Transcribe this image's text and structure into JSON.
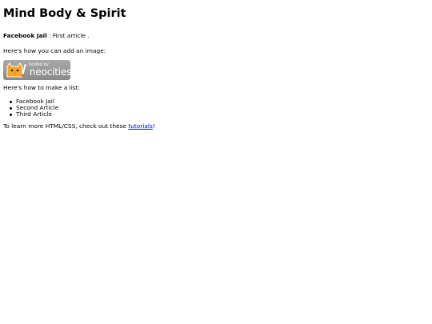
{
  "header": {
    "title": "Mind Body & Spirit"
  },
  "intro": {
    "bold_text": "Facebook Jail",
    "rest_text": " : First article ."
  },
  "image_section": {
    "text": "Here's how you can add an image:",
    "badge": {
      "small_text": "hosted by",
      "big_text": "neocities"
    }
  },
  "list_section": {
    "text": "Here's how to make a list:",
    "items": [
      "Facebook Jail",
      "Second Article",
      "Third Article"
    ]
  },
  "footer": {
    "prefix": "To learn more HTML/CSS, check out these ",
    "link": "tutorials",
    "suffix": "!"
  },
  "colors": {
    "link": "#0000ee",
    "badge_bg": "#999999",
    "cat": "#f5a623"
  }
}
